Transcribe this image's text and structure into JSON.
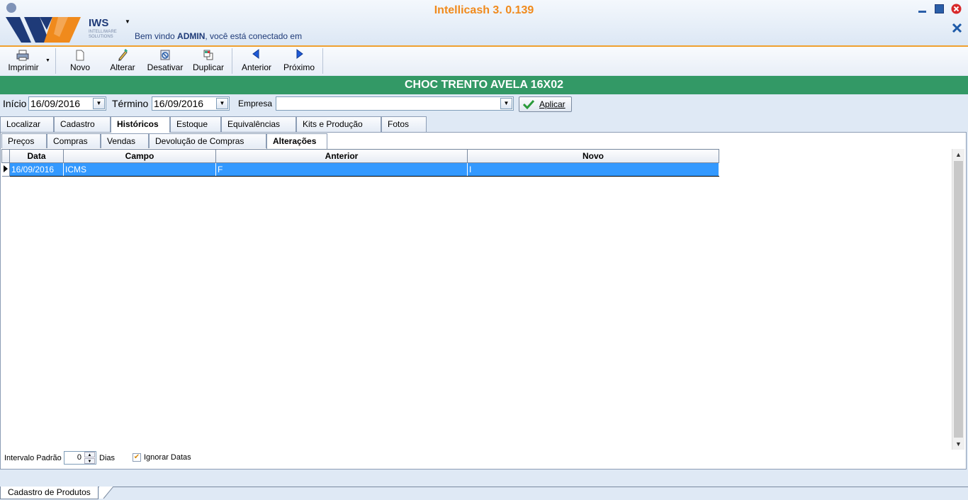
{
  "app": {
    "title": "Intellicash 3. 0.139",
    "logo_text": "IWS",
    "logo_sub": "INTELLIWARE SOLUTIONS",
    "welcome_prefix": "Bem vindo ",
    "welcome_user": "ADMIN",
    "welcome_suffix": ", você está conectado em"
  },
  "toolbar": {
    "imprimir": "Imprimir",
    "novo": "Novo",
    "alterar": "Alterar",
    "desativar": "Desativar",
    "duplicar": "Duplicar",
    "anterior": "Anterior",
    "proximo": "Próximo"
  },
  "product": {
    "name": "CHOC TRENTO AVELA 16X02"
  },
  "filter": {
    "inicio_label": "Início",
    "inicio_value": "16/09/2016",
    "termino_label": "Término",
    "termino_value": "16/09/2016",
    "empresa_label": "Empresa",
    "empresa_value": "",
    "aplicar": "Aplicar"
  },
  "main_tabs": [
    "Localizar",
    "Cadastro",
    "Históricos",
    "Estoque",
    "Equivalências",
    "Kits e Produção",
    "Fotos"
  ],
  "sub_tabs": [
    "Preços",
    "Compras",
    "Vendas",
    "Devolução de Compras",
    "Alterações"
  ],
  "grid": {
    "columns": [
      "Data",
      "Campo",
      "Anterior",
      "Novo"
    ],
    "rows": [
      {
        "data": "16/09/2016",
        "campo": "ICMS",
        "anterior": "F",
        "novo": "I"
      }
    ]
  },
  "bottom": {
    "intervalo_label": "Intervalo Padrão",
    "intervalo_value": "0",
    "dias_label": "Dias",
    "ignorar_label": "Ignorar Datas",
    "ignorar_checked": true
  },
  "status": {
    "doc_tab": "Cadastro de Produtos"
  },
  "colors": {
    "accent_orange": "#f08a1c",
    "header_green": "#339966",
    "selection_blue": "#3399ff"
  }
}
